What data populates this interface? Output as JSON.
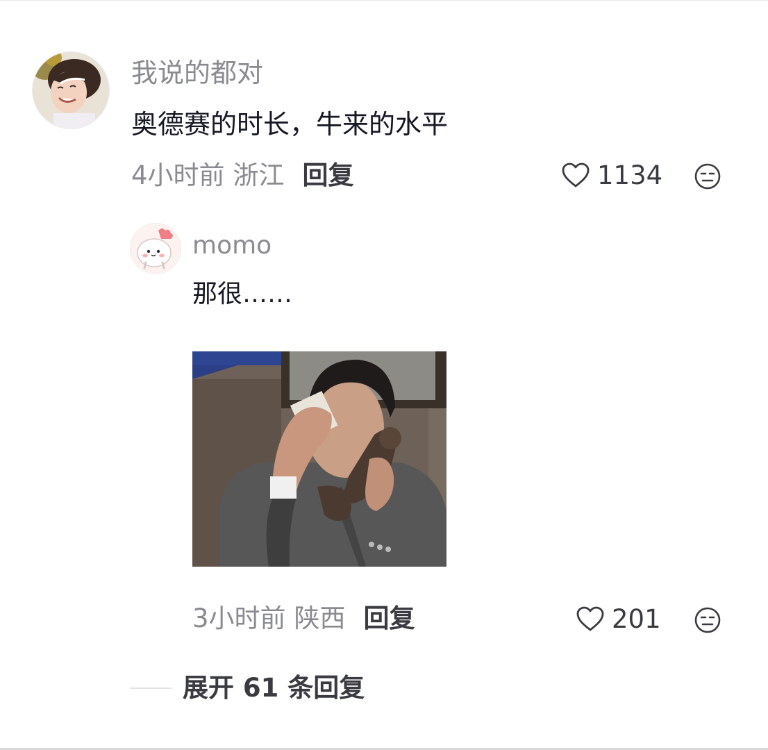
{
  "comment": {
    "username": "我说的都对",
    "text": "奥德赛的时长，牛来的水平",
    "time": "4小时前",
    "location": "浙江",
    "reply_label": "回复",
    "likes": "1134",
    "like_icon": "heart-outline-icon",
    "dislike_icon": "meh-face-icon"
  },
  "reply": {
    "username": "momo",
    "text": "那很……",
    "time": "3小时前",
    "location": "陕西",
    "reply_label": "回复",
    "likes": "201",
    "like_icon": "heart-outline-icon",
    "dislike_icon": "meh-face-icon"
  },
  "expand_label": "展开 61 条回复"
}
